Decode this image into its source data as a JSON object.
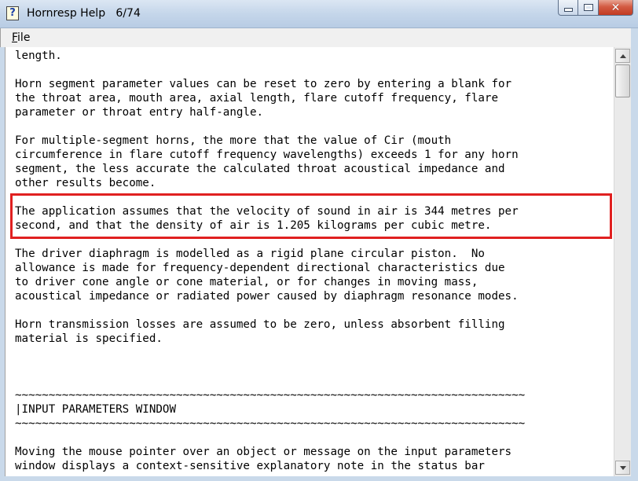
{
  "window": {
    "title": "Hornresp Help   6/74",
    "app_icon_glyph": "?",
    "icon": "help-question-icon"
  },
  "menu": {
    "file": {
      "mnemonic": "F",
      "rest": "ile"
    }
  },
  "content": {
    "lines": [
      "length.",
      "",
      "Horn segment parameter values can be reset to zero by entering a blank for",
      "the throat area, mouth area, axial length, flare cutoff frequency, flare",
      "parameter or throat entry half-angle.",
      "",
      "For multiple-segment horns, the more that the value of Cir (mouth",
      "circumference in flare cutoff frequency wavelengths) exceeds 1 for any horn",
      "segment, the less accurate the calculated throat acoustical impedance and",
      "other results become.",
      "",
      "The application assumes that the velocity of sound in air is 344 metres per",
      "second, and that the density of air is 1.205 kilograms per cubic metre.",
      "",
      "The driver diaphragm is modelled as a rigid plane circular piston.  No",
      "allowance is made for frequency-dependent directional characteristics due",
      "to driver cone angle or cone material, or for changes in moving mass,",
      "acoustical impedance or radiated power caused by diaphragm resonance modes.",
      "",
      "Horn transmission losses are assumed to be zero, unless absorbent filling",
      "material is specified.",
      "",
      "",
      "",
      "~~~~~~~~~~~~~~~~~~~~~~~~~~~~~~~~~~~~~~~~~~~~~~~~~~~~~~~~~~~~~~~~~~~~~~~~~~~~",
      "|INPUT PARAMETERS WINDOW",
      "~~~~~~~~~~~~~~~~~~~~~~~~~~~~~~~~~~~~~~~~~~~~~~~~~~~~~~~~~~~~~~~~~~~~~~~~~~~~",
      "",
      "Moving the mouse pointer over an object or message on the input parameters",
      "window displays a context-sensitive explanatory note in the status bar"
    ],
    "highlight_color": "#e02020"
  },
  "close_glyph": "✕"
}
